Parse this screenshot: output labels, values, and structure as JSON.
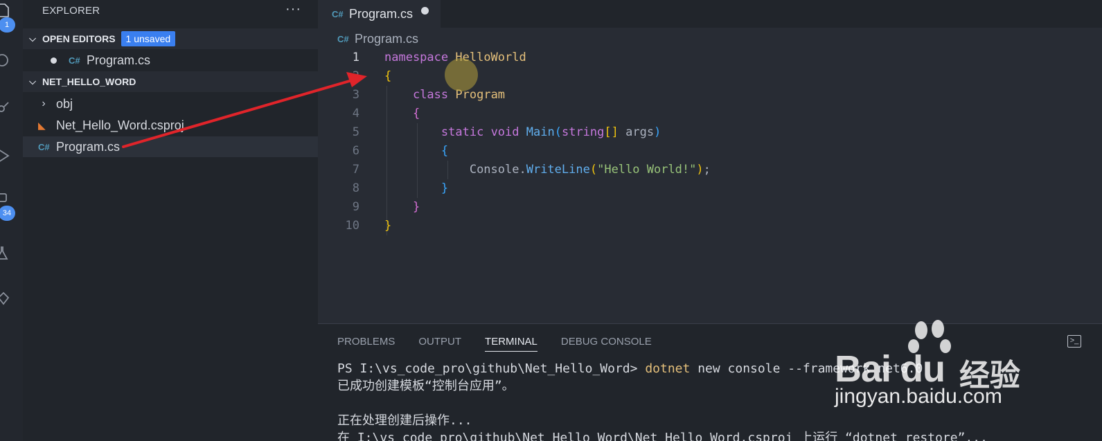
{
  "activity_bar": {
    "explorer_badge": "1",
    "extensions_badge": "34",
    "icons": [
      "files-icon",
      "search-icon",
      "source-control-icon",
      "run-debug-icon",
      "extensions-icon",
      "testing-icon",
      "remote-icon"
    ]
  },
  "sidebar": {
    "title": "EXPLORER",
    "more": "···",
    "open_editors": {
      "label": "OPEN EDITORS",
      "badge": "1 unsaved",
      "items": [
        {
          "icon": "C#",
          "name": "Program.cs",
          "dirty": true
        }
      ]
    },
    "project": {
      "label": "NET_HELLO_WORD",
      "items": [
        {
          "type": "folder",
          "name": "obj"
        },
        {
          "type": "csproj",
          "name": "Net_Hello_Word.csproj"
        },
        {
          "type": "cs",
          "name": "Program.cs",
          "selected": true
        }
      ]
    }
  },
  "editor": {
    "tab_label": "Program.cs",
    "breadcrumb": "Program.cs",
    "icon_text": "C#",
    "line_numbers": [
      "1",
      "2",
      "3",
      "4",
      "5",
      "6",
      "7",
      "8",
      "9",
      "10"
    ],
    "code": {
      "l1_kw": "namespace",
      "l1_name": "HelloWorld",
      "l2": "{",
      "l3_kw": "class",
      "l3_name": "Program",
      "l4": "{",
      "l5_mod": "static",
      "l5_ret": "void",
      "l5_fn": "Main",
      "l5_open": "(",
      "l5_type": "string",
      "l5_arr": "[]",
      "l5_arg": " args",
      "l5_close": ")",
      "l6": "{",
      "l7_obj": "Console.",
      "l7_fn": "WriteLine",
      "l7_open": "(",
      "l7_str": "\"Hello World!\"",
      "l7_close": ")",
      "l7_semi": ";",
      "l8": "}",
      "l9": "}",
      "l10": "}"
    }
  },
  "panel": {
    "tabs": [
      "PROBLEMS",
      "OUTPUT",
      "TERMINAL",
      "DEBUG CONSOLE"
    ],
    "active_tab": "TERMINAL",
    "terminal": {
      "prompt": "PS I:\\vs_code_pro\\github\\Net_Hello_Word> ",
      "cmd": "dotnet",
      "cmd_rest": " new console --framework net6.0",
      "line2": "已成功创建模板“控制台应用”。",
      "line3": "",
      "line4": "正在处理创建后操作...",
      "line5": "在 I:\\vs_code_pro\\github\\Net_Hello_Word\\Net_Hello_Word.csproj 上运行 “dotnet restore”..."
    }
  },
  "watermark": {
    "brand": "Bai du",
    "cn": "经验",
    "url": "jingyan.baidu.com"
  },
  "colors": {
    "accent": "#3a7ff0",
    "arrow": "#e0242a",
    "keyword": "#c678dd",
    "type": "#e5c07b",
    "function": "#61afef",
    "string": "#98c379"
  }
}
